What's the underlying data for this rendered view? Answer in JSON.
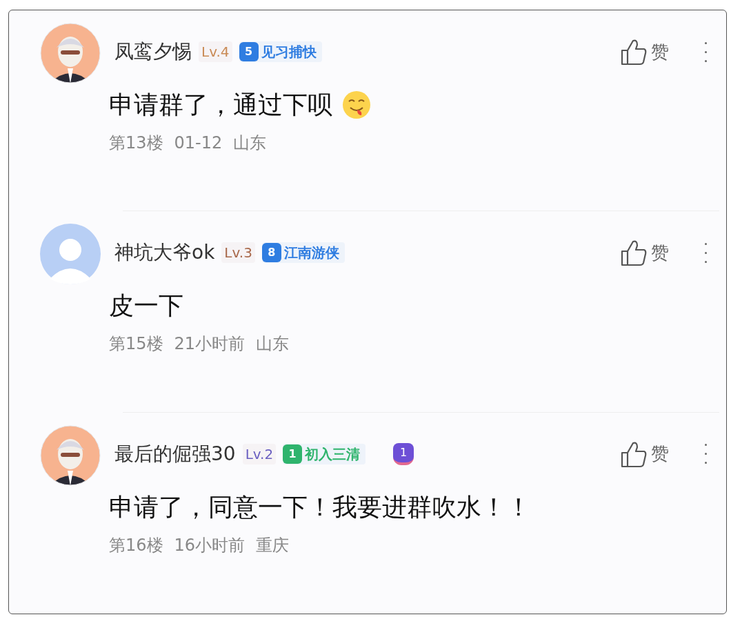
{
  "comments": [
    {
      "name": "凤鸾夕惕",
      "level": {
        "text": "Lv.4",
        "color": "#c98a55"
      },
      "title_badge": {
        "number": "5",
        "text": "见习捕快",
        "color": "#2f7de1"
      },
      "text": "申请群了，通过下呗",
      "emoji": true,
      "floor": "第13楼",
      "time": "01-12",
      "location": "山东",
      "like": "赞"
    },
    {
      "avatar": {
        "kind": "default"
      },
      "name": "神坑大爷ok",
      "level": {
        "text": "Lv.3",
        "color": "#a8684a"
      },
      "title_badge": {
        "number": "8",
        "text": "江南游侠",
        "color": "#2f7de1"
      },
      "text": "皮一下",
      "emoji": false,
      "floor": "第15楼",
      "time": "21小时前",
      "location": "山东",
      "like": "赞"
    },
    {
      "name": "最后的倔强30",
      "level": {
        "text": "Lv.2",
        "color": "#6a5fc1"
      },
      "title_badge": {
        "number": "1",
        "text": "初入三清",
        "color": "#2fb46d"
      },
      "medal": "1",
      "text": "申请了，同意一下！我要进群吹水！！",
      "emoji": false,
      "floor": "第16楼",
      "time": "16小时前",
      "location": "重庆",
      "like": "赞"
    }
  ]
}
